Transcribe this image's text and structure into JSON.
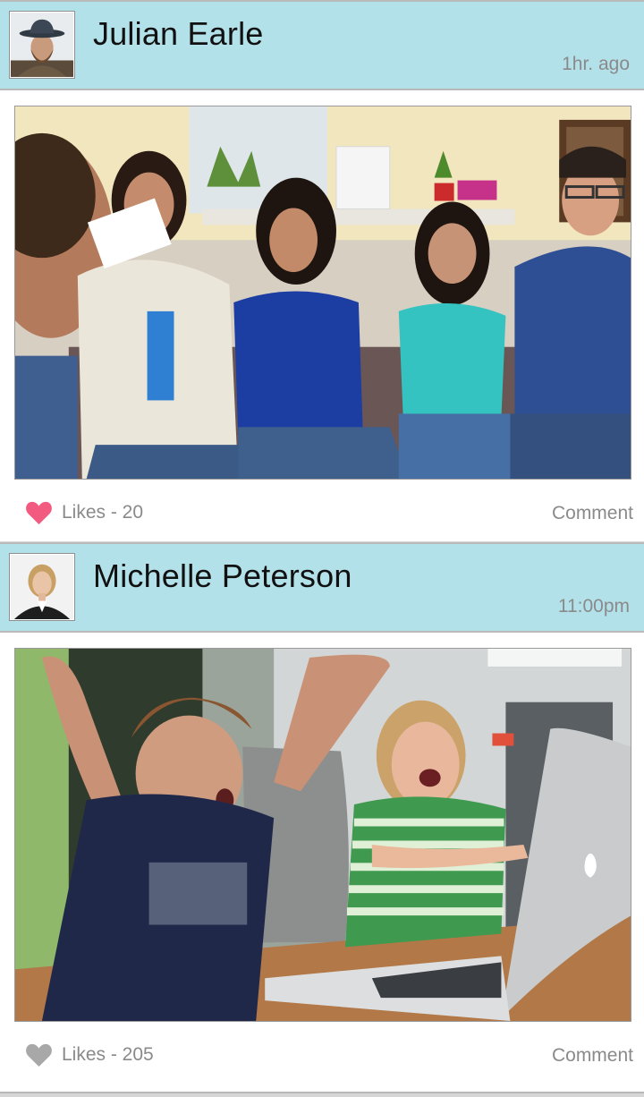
{
  "posts": [
    {
      "author": "Julian Earle",
      "time": "1hr. ago",
      "likes_text": "Likes - 20",
      "comment_label": "Comment",
      "liked": true,
      "heart_color": "#f25a7f"
    },
    {
      "author": "Michelle Peterson",
      "time": "11:00pm",
      "likes_text": "Likes - 205",
      "comment_label": "Comment",
      "liked": false,
      "heart_color": "#a8a8a8"
    }
  ],
  "colors": {
    "header_bg": "#b3e1ea",
    "secondary_text": "#8a8a8a",
    "liked_heart": "#f25a7f",
    "unliked_heart": "#a8a8a8"
  },
  "icons": {
    "like": "heart-icon"
  }
}
